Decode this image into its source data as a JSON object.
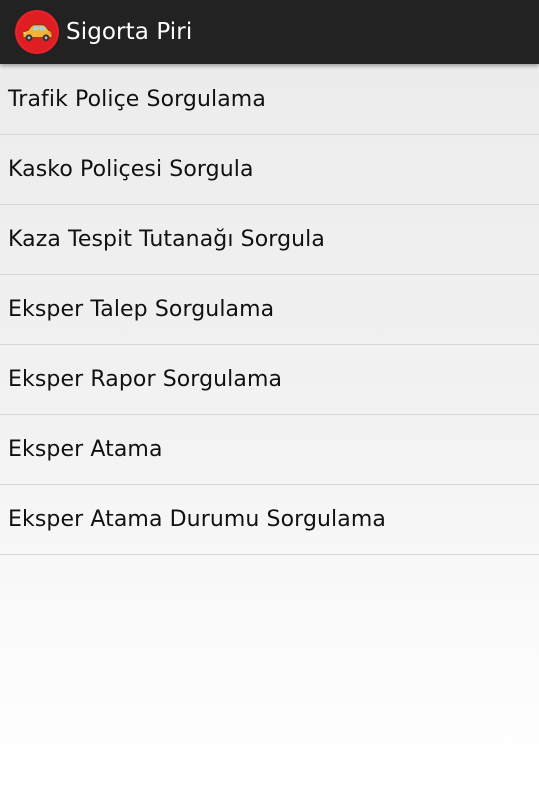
{
  "app_bar": {
    "title": "Sigorta Piri",
    "logo_icon": "red-car-logo-icon",
    "background": "#222222",
    "logo_color": "#e8232a"
  },
  "menu": {
    "items": [
      {
        "label": "Trafik Poliçe Sorgulama"
      },
      {
        "label": "Kasko Poliçesi Sorgula"
      },
      {
        "label": "Kaza Tespit Tutanağı Sorgula"
      },
      {
        "label": "Eksper Talep Sorgulama"
      },
      {
        "label": "Eksper Rapor Sorgulama"
      },
      {
        "label": "Eksper Atama"
      },
      {
        "label": "Eksper Atama Durumu Sorgulama"
      }
    ]
  }
}
